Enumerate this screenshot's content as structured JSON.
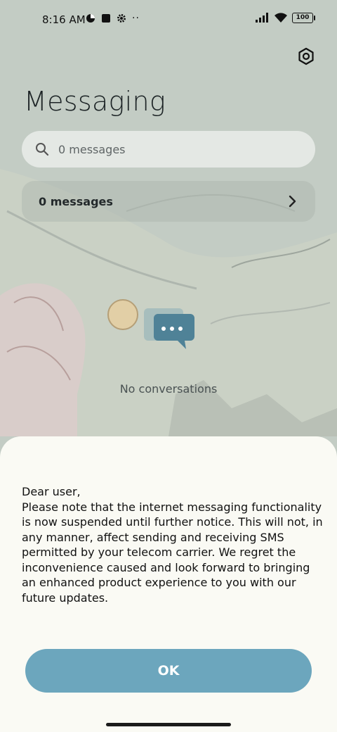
{
  "status_bar": {
    "time": "8:16 AM",
    "battery": "100"
  },
  "header": {
    "title": "Messaging"
  },
  "search": {
    "placeholder": "0 messages"
  },
  "summary_row": {
    "label": "0 messages"
  },
  "empty_state": {
    "text": "No conversations"
  },
  "dialog": {
    "greeting": "Dear user,",
    "body": "Please note that the internet messaging functionality is now suspended until further notice. This will not, in any manner, affect sending and receiving SMS permitted by your telecom carrier. We regret the inconvenience caused and look forward to bringing an enhanced product experience to you with our future updates.",
    "ok_label": "OK"
  },
  "colors": {
    "accent": "#6ca6bd",
    "sheet": "#fafaf4",
    "bubble": "#4f8297"
  }
}
